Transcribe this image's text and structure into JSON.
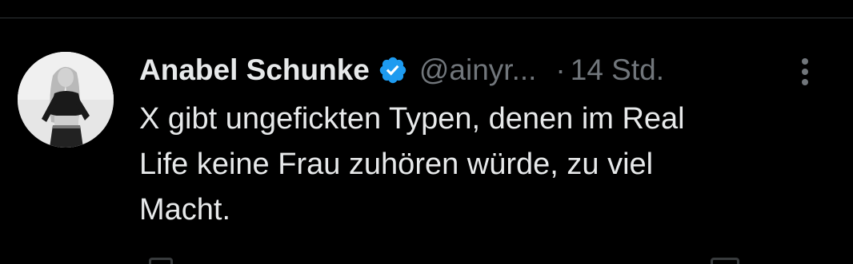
{
  "tweet": {
    "author": {
      "display_name": "Anabel Schunke",
      "handle": "@ainyr...",
      "verified": true,
      "avatar_icon": "profile-photo"
    },
    "separator": "·",
    "timestamp": "14 Std.",
    "text_lines": [
      "X gibt ungefickten Typen, denen im Real",
      "Life keine Frau zuhören würde, zu viel",
      "Macht."
    ],
    "more_icon": "vertical-ellipsis-icon"
  },
  "colors": {
    "background": "#000000",
    "text_primary": "#e7e9ea",
    "text_secondary": "#71767b",
    "verified_blue": "#1d9bf0",
    "divider": "#2f3336"
  }
}
